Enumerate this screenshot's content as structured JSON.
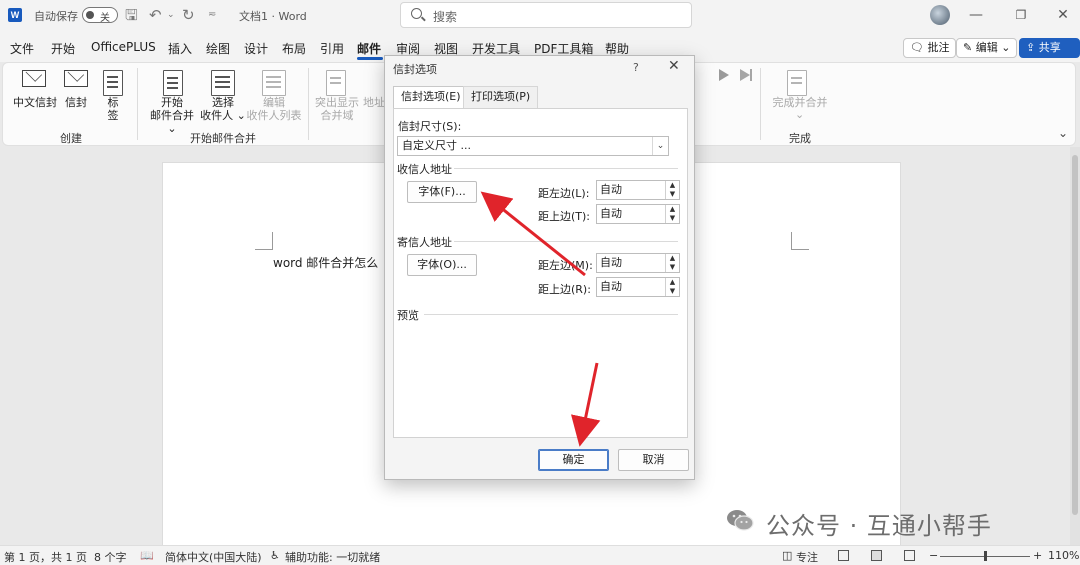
{
  "titlebar": {
    "autosave_label": "自动保存",
    "toggle_state": "关",
    "doc_title": "文档1 · Word",
    "search_placeholder": "搜索",
    "icons": [
      "word-logo",
      "save-icon",
      "undo-icon",
      "redo-icon",
      "customize-icon",
      "avatar",
      "minimize-icon",
      "restore-icon",
      "close-icon"
    ]
  },
  "menu": {
    "items": [
      "文件",
      "开始",
      "OfficePLUS",
      "插入",
      "绘图",
      "设计",
      "布局",
      "引用",
      "邮件",
      "审阅",
      "视图",
      "开发工具",
      "PDF工具箱",
      "帮助"
    ],
    "active": "邮件",
    "comment_button": "批注",
    "edit_button": "编辑",
    "share_button": "共享"
  },
  "ribbon": {
    "create_group": "创建",
    "start_group": "开始邮件合并",
    "finish_group": "完成",
    "chinese_envelope": "中文信封",
    "envelope": "信封",
    "label_line1": "标",
    "label_line2": "签",
    "start_merge_line1": "开始",
    "start_merge_line2": "邮件合并",
    "select_line1": "选择",
    "select_line2": "收件人",
    "edit_line1": "编辑",
    "edit_line2": "收件人列表",
    "highlight_line1": "突出显示",
    "highlight_line2": "合并域",
    "address_block": "地址",
    "finish_merge": "完成并合并"
  },
  "document": {
    "text": "word 邮件合并怎么"
  },
  "dialog": {
    "title": "信封选项",
    "help": "?",
    "tab_envelope": "信封选项(E)",
    "tab_print": "打印选项(P)",
    "size_label": "信封尺寸(S):",
    "size_value": "自定义尺寸 ...",
    "recipient_section": "收信人地址",
    "recipient_font_button": "字体(F)...",
    "recipient_left_label": "距左边(L):",
    "recipient_left_value": "自动",
    "recipient_top_label": "距上边(T):",
    "recipient_top_value": "自动",
    "sender_section": "寄信人地址",
    "sender_font_button": "字体(O)...",
    "sender_left_label": "距左边(M):",
    "sender_left_value": "自动",
    "sender_top_label": "距上边(R):",
    "sender_top_value": "自动",
    "preview_label": "预览",
    "ok_button": "确定",
    "cancel_button": "取消"
  },
  "watermark": {
    "text": "公众号 · 互通小帮手"
  },
  "statusbar": {
    "page_info": "第 1 页，共 1 页",
    "word_count": "8 个字",
    "language": "简体中文(中国大陆)",
    "accessibility": "辅助功能: 一切就绪",
    "focus": "专注",
    "zoom": "110%"
  },
  "colors": {
    "accent": "#185abd",
    "annotation_arrow": "#e0242b"
  }
}
